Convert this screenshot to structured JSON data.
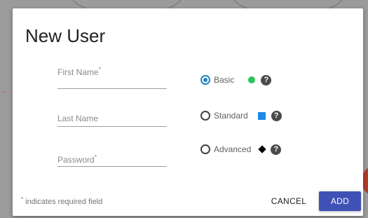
{
  "dialog": {
    "title": "New User",
    "fields": {
      "first_name": {
        "label": "First Name",
        "required_mark": "*",
        "value": ""
      },
      "last_name": {
        "label": "Last Name",
        "value": ""
      },
      "password": {
        "label": "Password",
        "required_mark": "*",
        "value": ""
      }
    },
    "plans": [
      {
        "label": "Basic",
        "selected": true,
        "symbol": "circle",
        "symbol_color": "#2ec45a"
      },
      {
        "label": "Standard",
        "selected": false,
        "symbol": "square",
        "symbol_color": "#1e88e5"
      },
      {
        "label": "Advanced",
        "selected": false,
        "symbol": "diamond",
        "symbol_color": "#000000"
      }
    ],
    "help_glyph": "?",
    "footer": {
      "required_mark": "*",
      "note": " indicates required field"
    },
    "buttons": {
      "cancel": "CANCEL",
      "add": "ADD"
    },
    "colors": {
      "accent": "#3f51b5",
      "radio_selected": "#1e88c8"
    }
  }
}
